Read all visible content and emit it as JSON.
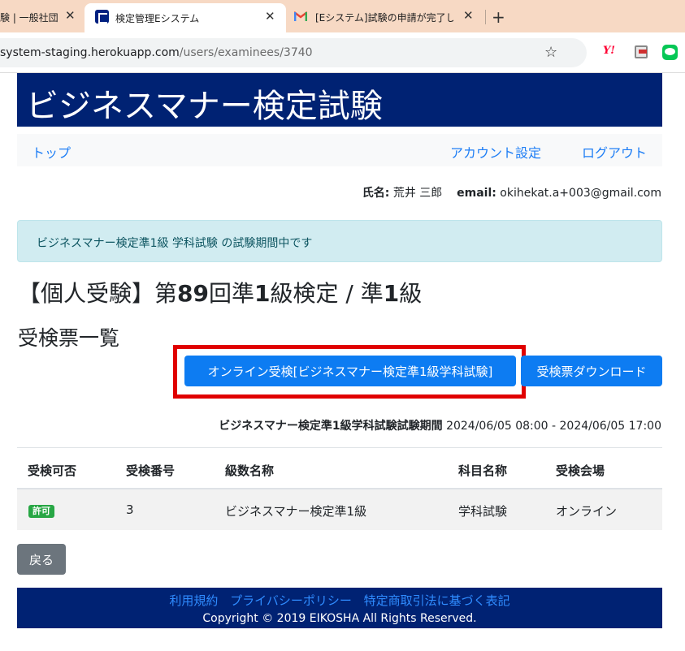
{
  "browser": {
    "tabs": [
      {
        "label": "験 | 一般社団",
        "close": "✕"
      },
      {
        "label": "検定管理Eシステム",
        "close": "✕"
      },
      {
        "label": "[Eシステム]試験の申請が完了しまし",
        "close": "✕"
      }
    ],
    "new_tab": "+",
    "url_host": "system-staging.herokuapp.com",
    "url_path": "/users/examinees/3740",
    "star": "☆",
    "ext_yahoo": "Y!"
  },
  "header": {
    "title": "ビジネスマナー検定試験"
  },
  "nav": {
    "top": "トップ",
    "account": "アカウント設定",
    "logout": "ログアウト"
  },
  "user": {
    "name_label": "氏名:",
    "name": "荒井 三郎",
    "email_label": "email:",
    "email": "okihekat.a+003@gmail.com"
  },
  "alert": {
    "text": "ビジネスマナー検定準1級 学科試験 の試験期間中です"
  },
  "exam": {
    "title_prefix": "【個人受験】第",
    "title_num": "89",
    "title_mid": "回準",
    "title_num2": "1",
    "title_mid2": "級検定 / 準",
    "title_num3": "1",
    "title_suffix": "級",
    "section": "受検票一覧"
  },
  "buttons": {
    "online": "オンライン受検[ビジネスマナー検定準1級学科試験]",
    "download": "受検票ダウンロード",
    "back": "戻る"
  },
  "period": {
    "label": "ビジネスマナー検定準1級学科試験試験期間",
    "value": "2024/06/05 08:00 - 2024/06/05 17:00"
  },
  "table": {
    "headers": [
      "受検可否",
      "受検番号",
      "級数名称",
      "科目名称",
      "受検会場"
    ],
    "rows": [
      {
        "status": "許可",
        "number": "3",
        "grade": "ビジネスマナー検定準1級",
        "subject": "学科試験",
        "venue": "オンライン"
      }
    ]
  },
  "footer": {
    "links": [
      "利用規約",
      "プライバシーポリシー",
      "特定商取引法に基づく表記"
    ],
    "copyright": "Copyright © 2019 EIKOSHA All Rights Reserved."
  },
  "colors": {
    "brand": "#002273",
    "primary": "#0d7cf2",
    "highlight": "#e00000",
    "success": "#28a745"
  }
}
